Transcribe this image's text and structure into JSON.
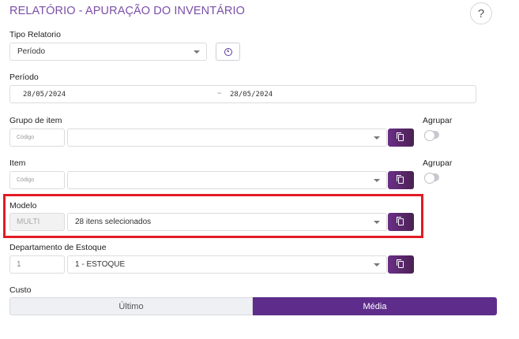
{
  "page": {
    "title": "RELATÓRIO - APURAÇÃO DO INVENTÁRIO",
    "help_label": "?"
  },
  "tipo_relatorio": {
    "label": "Tipo Relatorio",
    "value": "Período"
  },
  "periodo": {
    "label": "Período",
    "start": "28/05/2024",
    "separator": "~",
    "end": "28/05/2024"
  },
  "grupo_item": {
    "label": "Grupo de item",
    "code_placeholder": "Código",
    "value": "",
    "agrupar_label": "Agrupar"
  },
  "item": {
    "label": "Item",
    "code_placeholder": "Código",
    "value": "",
    "agrupar_label": "Agrupar"
  },
  "modelo": {
    "label": "Modelo",
    "code_value": "MULTI",
    "value": "28 itens selecionados"
  },
  "departamento": {
    "label": "Departamento de Estoque",
    "code_value": "1",
    "value": "1 - ESTOQUE"
  },
  "custo": {
    "label": "Custo",
    "options": [
      "Último",
      "Média"
    ],
    "selected": "Média"
  },
  "colors": {
    "accent": "#5e2d8b",
    "highlight_border": "#e21b23",
    "title": "#7b4fa8"
  }
}
